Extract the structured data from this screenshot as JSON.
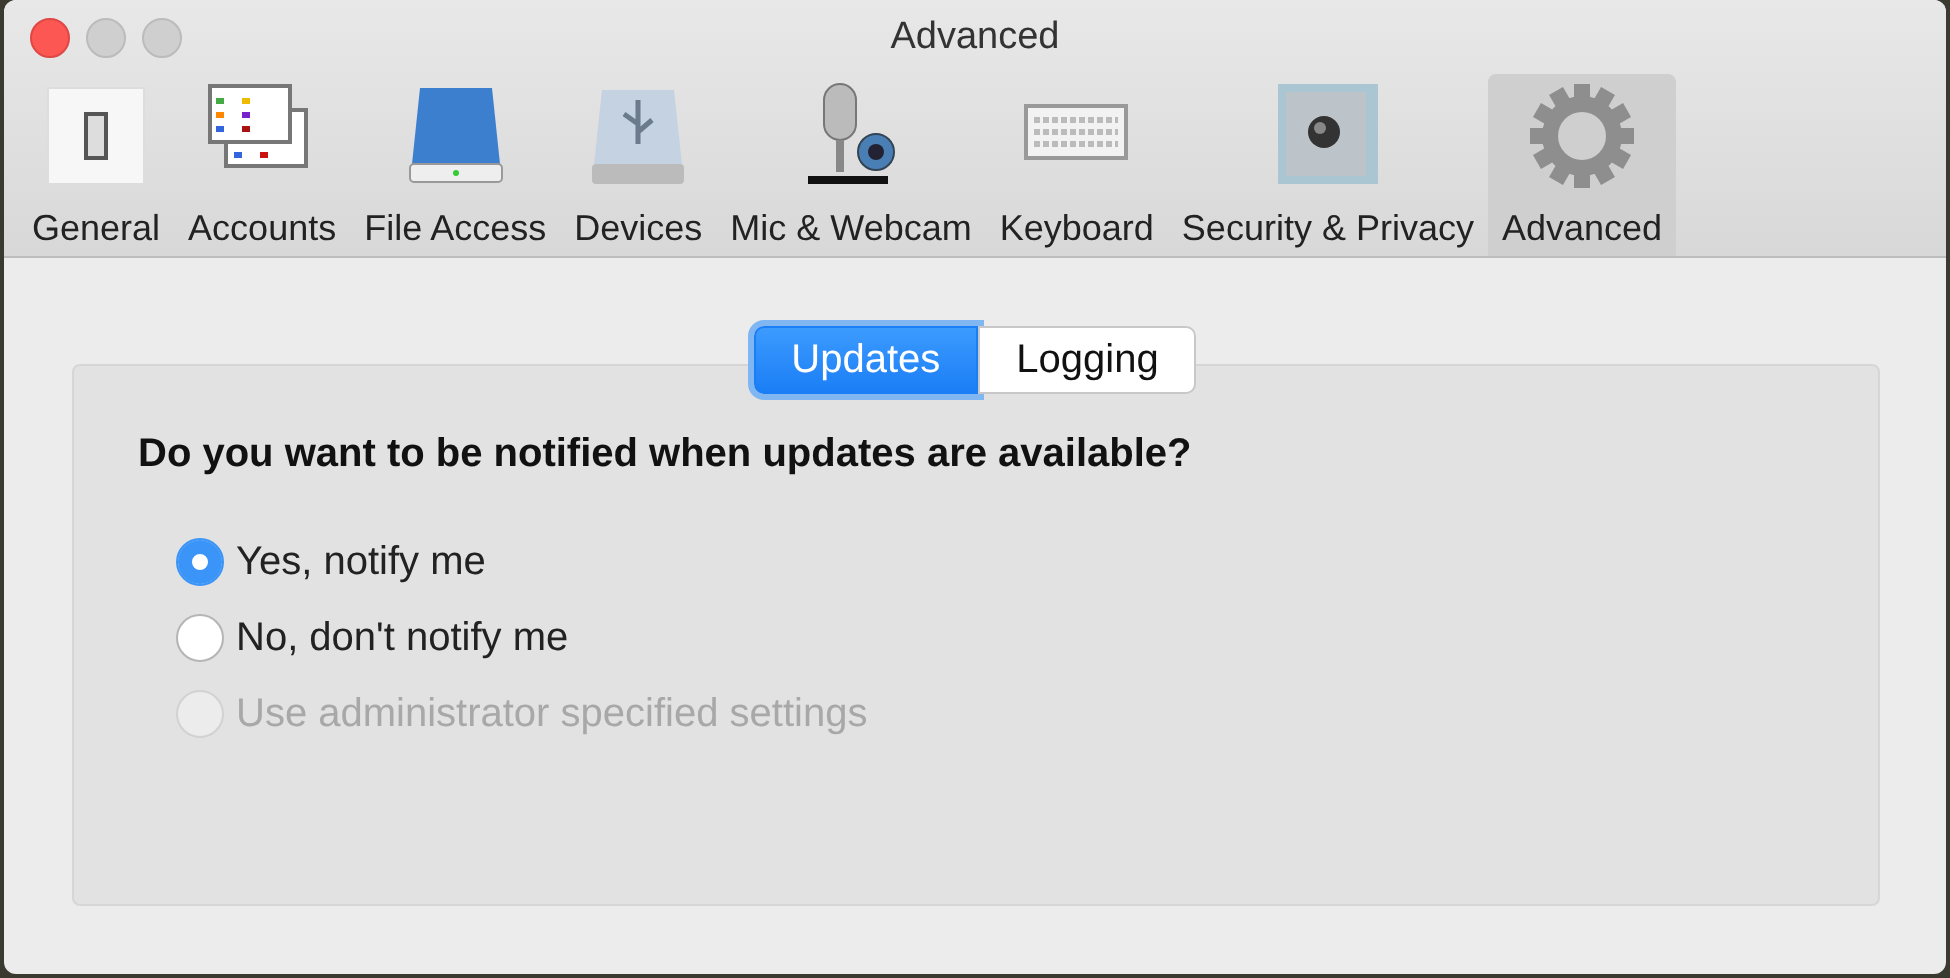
{
  "window": {
    "title": "Advanced"
  },
  "toolbar": [
    {
      "label": "General",
      "selected": false
    },
    {
      "label": "Accounts",
      "selected": false
    },
    {
      "label": "File Access",
      "selected": false
    },
    {
      "label": "Devices",
      "selected": false
    },
    {
      "label": "Mic & Webcam",
      "selected": false
    },
    {
      "label": "Keyboard",
      "selected": false
    },
    {
      "label": "Security & Privacy",
      "selected": false
    },
    {
      "label": "Advanced",
      "selected": true
    }
  ],
  "segments": [
    {
      "label": "Updates",
      "selected": true
    },
    {
      "label": "Logging",
      "selected": false
    }
  ],
  "question": "Do you want to be notified when updates are available?",
  "options": [
    {
      "label": "Yes, notify me",
      "selected": true,
      "disabled": false
    },
    {
      "label": "No, don't notify me",
      "selected": false,
      "disabled": false
    },
    {
      "label": "Use administrator specified settings",
      "selected": false,
      "disabled": true
    }
  ]
}
